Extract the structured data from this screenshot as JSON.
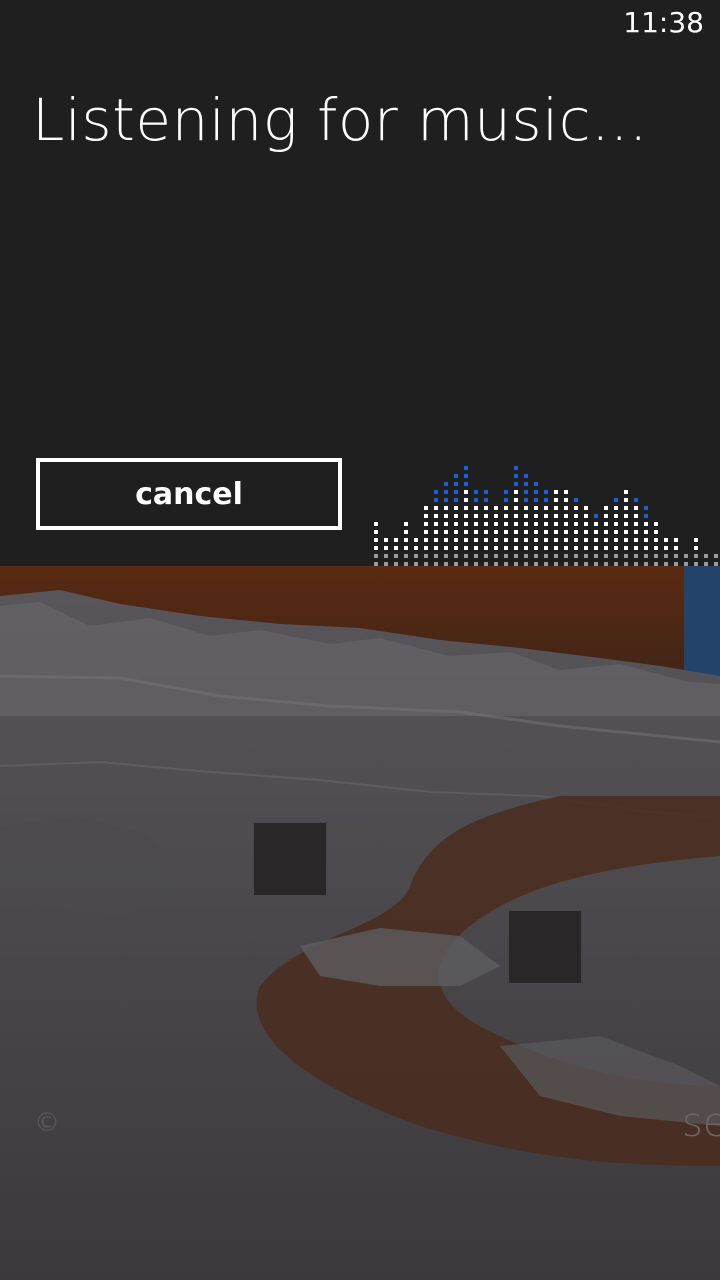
{
  "status_bar": {
    "time": "11:38"
  },
  "listening": {
    "title": "Listening for music...",
    "cancel_label": "cancel"
  },
  "footer": {
    "copyright_symbol": "©",
    "side_text": "se"
  },
  "colors": {
    "background": "#1f1f1f",
    "accent_blue": "#1a5fd6",
    "visualizer_dot": "#ffffff"
  },
  "visualizer": {
    "white_levels": [
      3,
      2,
      2,
      3,
      2,
      4,
      4,
      4,
      4,
      5,
      4,
      4,
      4,
      4,
      5,
      4,
      4,
      4,
      5,
      5,
      4,
      4,
      3,
      4,
      4,
      5,
      4,
      3,
      3,
      2,
      2,
      1,
      2,
      1,
      1
    ],
    "blue_levels": [
      0,
      0,
      0,
      0,
      0,
      0,
      2,
      3,
      4,
      3,
      2,
      2,
      0,
      2,
      3,
      4,
      3,
      2,
      0,
      0,
      1,
      0,
      1,
      0,
      1,
      0,
      1,
      2,
      0,
      0,
      0,
      0,
      0,
      0,
      0
    ]
  }
}
